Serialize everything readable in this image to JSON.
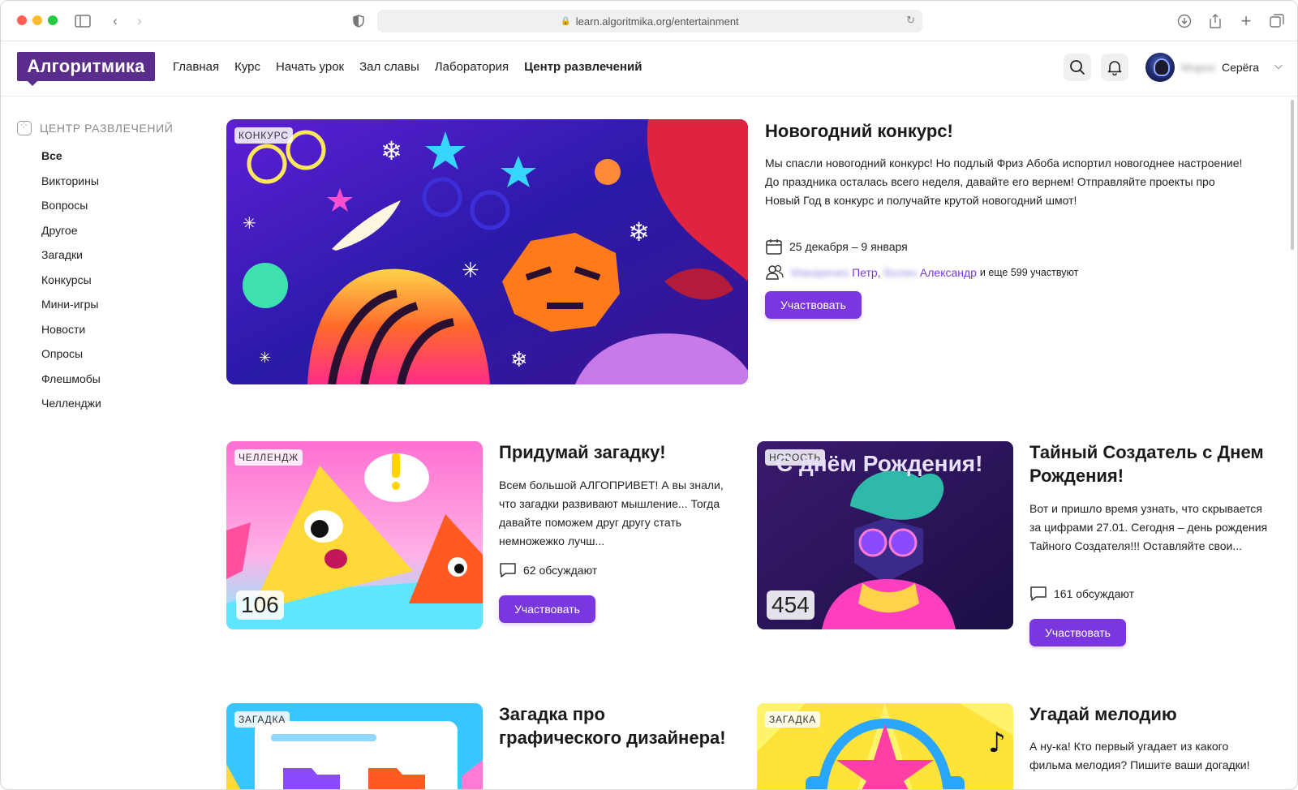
{
  "browser": {
    "url": "learn.algoritmika.org/entertainment",
    "colors": {
      "close": "#ff5f57",
      "minimize": "#febc2e",
      "zoom": "#28c840"
    }
  },
  "header": {
    "logo": "Алгоритмика",
    "nav": [
      {
        "label": "Главная"
      },
      {
        "label": "Курс"
      },
      {
        "label": "Начать урок"
      },
      {
        "label": "Зал славы"
      },
      {
        "label": "Лаборатория"
      },
      {
        "label": "Центр развлечений",
        "active": true
      }
    ],
    "user": {
      "surname": "Морох",
      "name": "Серёга"
    },
    "brand_color": "#5a2d8c"
  },
  "sidebar": {
    "title": "ЦЕНТР РАЗВЛЕЧЕНИЙ",
    "items": [
      {
        "label": "Все",
        "active": true
      },
      {
        "label": "Викторины"
      },
      {
        "label": "Вопросы"
      },
      {
        "label": "Другое"
      },
      {
        "label": "Загадки"
      },
      {
        "label": "Конкурсы"
      },
      {
        "label": "Мини-игры"
      },
      {
        "label": "Новости"
      },
      {
        "label": "Опросы"
      },
      {
        "label": "Флешмобы"
      },
      {
        "label": "Челленджи"
      }
    ]
  },
  "featured": {
    "tag": "КОНКУРС",
    "title": "Новогодний конкурс!",
    "description": "Мы спасли новогодний конкурс! Но подлый Фриз Абоба испортил новогоднее настроение! До праздника осталась всего неделя, давайте его вернем! Отправляйте проекты про Новый Год в конкурс и получайте крутой новогодний шмот!",
    "dates": "25 декабря – 9 января",
    "participants": {
      "blurred_1": "Макаренко",
      "name_1": "Петр,",
      "blurred_2": "Волин",
      "name_2": "Александр",
      "suffix": "и еще 599 участвуют"
    },
    "button": "Участвовать"
  },
  "cards": [
    {
      "tag": "ЧЕЛЛЕНДЖ",
      "count": "106",
      "title": "Придумай загадку!",
      "description": "Всем большой АЛГОПРИВЕТ! А вы знали, что загадки развивают мышление... Тогда давайте поможем друг другу стать немножежко лучш...",
      "discuss": "62 обсуждают",
      "button": "Участвовать"
    },
    {
      "tag": "НОВОСТЬ",
      "count": "454",
      "image_text": "С днём Рождения!",
      "title": "Тайный Создатель с Днем Рождения!",
      "description": "Вот и пришло время узнать, что скрывается за цифрами 27.01. Сегодня – день рождения Тайного Создателя!!! Оставляйте свои...",
      "discuss": "161 обсуждают",
      "button": "Участвовать"
    },
    {
      "tag": "ЗАГАДКА",
      "title": "Загадка про графического дизайнера!"
    },
    {
      "tag": "ЗАГАДКА",
      "title": "Угадай мелодию",
      "description": "А ну-ка! Кто первый угадает из какого фильма мелодия? Пишите ваши догадки!"
    }
  ],
  "accent_color": "#7a37e0"
}
